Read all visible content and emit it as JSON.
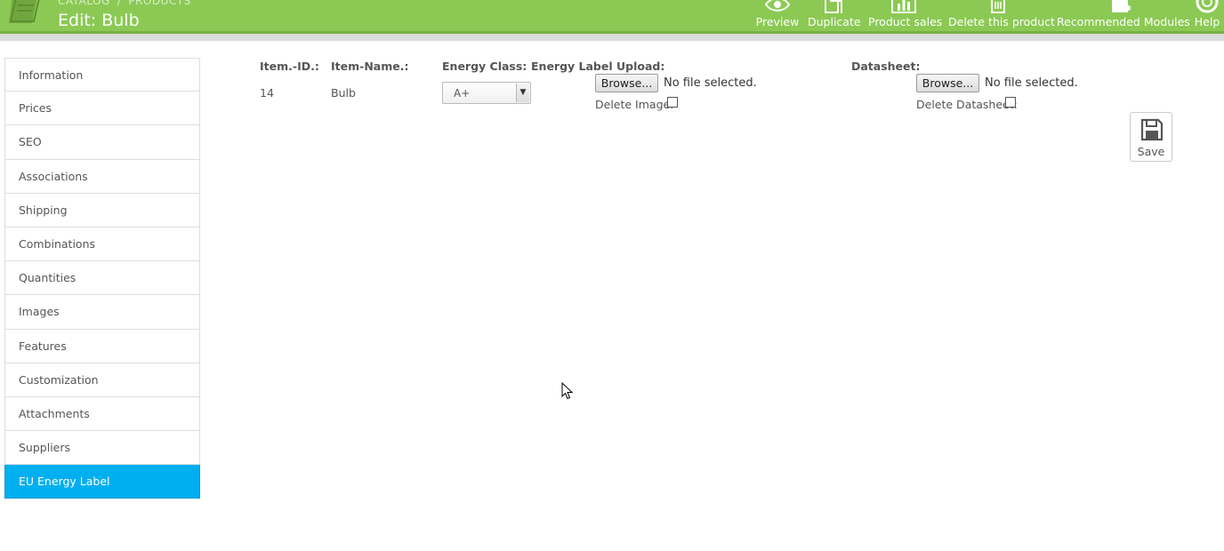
{
  "header": {
    "breadcrumb": [
      "CATALOG",
      "PRODUCTS"
    ],
    "breadcrumb_sep": "/",
    "title": "Edit: Bulb",
    "accent_color": "#8bc954",
    "toolbar": [
      {
        "id": "preview",
        "label": "Preview",
        "icon": "eye-icon"
      },
      {
        "id": "duplicate",
        "label": "Duplicate",
        "icon": "copy-icon"
      },
      {
        "id": "product-sales",
        "label": "Product sales",
        "icon": "bar-chart-icon"
      },
      {
        "id": "delete-product",
        "label": "Delete this product",
        "icon": "trash-icon"
      },
      {
        "id": "recommended-modules",
        "label": "Recommended Modules",
        "icon": "puzzle-icon"
      },
      {
        "id": "help",
        "label": "Help",
        "icon": "lifebuoy-icon"
      }
    ]
  },
  "sidebar": {
    "active_color": "#00aff0",
    "items": [
      {
        "label": "Information"
      },
      {
        "label": "Prices"
      },
      {
        "label": "SEO"
      },
      {
        "label": "Associations"
      },
      {
        "label": "Shipping"
      },
      {
        "label": "Combinations"
      },
      {
        "label": "Quantities"
      },
      {
        "label": "Images"
      },
      {
        "label": "Features"
      },
      {
        "label": "Customization"
      },
      {
        "label": "Attachments"
      },
      {
        "label": "Suppliers"
      },
      {
        "label": "EU Energy Label",
        "active": true
      }
    ]
  },
  "form": {
    "headers": {
      "item_id": "Item.-ID.:",
      "item_name": "Item-Name.:",
      "energy_class": "Energy Class:",
      "energy_label_upload": "Energy Label Upload:",
      "datasheet": "Datasheet:"
    },
    "row": {
      "item_id": "14",
      "item_name": "Bulb",
      "energy_class": "A+"
    },
    "energy_label": {
      "browse_label": "Browse...",
      "file_status": "No file selected.",
      "delete_label": "Delete Image:"
    },
    "datasheet": {
      "browse_label": "Browse...",
      "file_status": "No file selected.",
      "delete_label": "Delete Datasheet:"
    },
    "save_label": "Save"
  }
}
